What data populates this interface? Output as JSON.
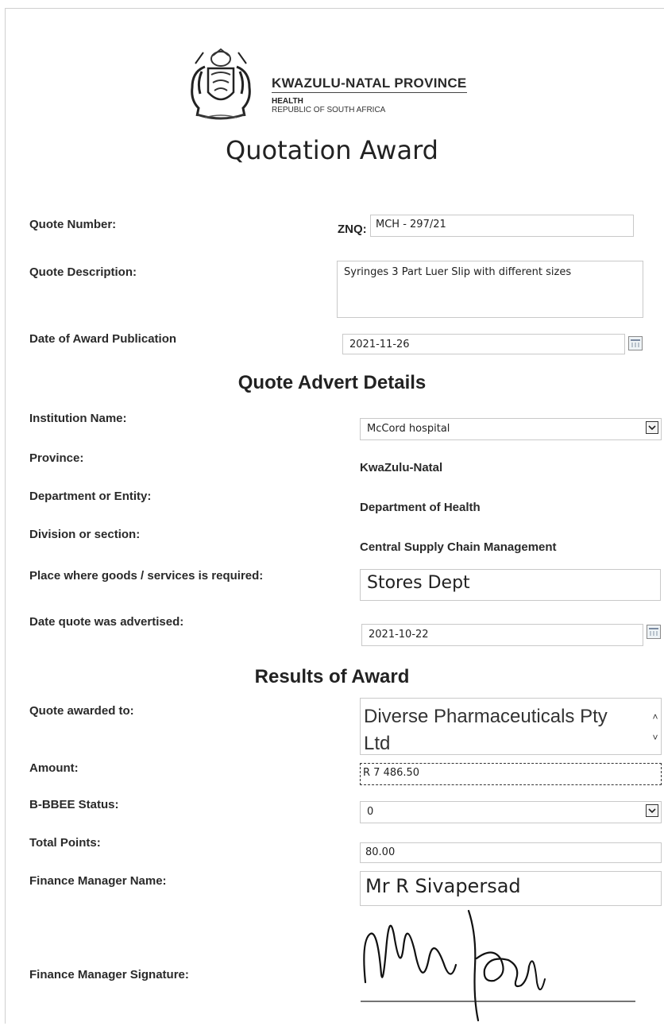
{
  "header": {
    "province_line": "KWAZULU-NATAL PROVINCE",
    "dept_line": "HEALTH",
    "country_line": "REPUBLIC OF SOUTH AFRICA"
  },
  "title": "Quotation Award",
  "quote": {
    "number_label": "Quote Number:",
    "number_prefix": "ZNQ:",
    "number_value": "MCH - 297/21",
    "description_label": "Quote Description:",
    "description_value": "Syringes 3 Part Luer Slip with different sizes",
    "award_date_label": "Date of Award Publication",
    "award_date_value": "2021-11-26"
  },
  "advert": {
    "heading": "Quote Advert Details",
    "institution_label": "Institution Name:",
    "institution_value": "McCord hospital",
    "province_label": "Province:",
    "province_value": "KwaZulu-Natal",
    "department_label": "Department or Entity:",
    "department_value": "Department of Health",
    "division_label": "Division or section:",
    "division_value": "Central Supply Chain Management",
    "place_label": "Place where goods /  services is required:",
    "place_value": "Stores Dept",
    "advertised_label": "Date quote was advertised:",
    "advertised_value": "2021-10-22"
  },
  "results": {
    "heading": "Results of Award",
    "awarded_label": "Quote awarded to:",
    "awarded_value_line1": "Diverse Pharmaceuticals Pty",
    "awarded_value_line2": "Ltd",
    "amount_label": "Amount:",
    "amount_value": "R 7 486.50",
    "bbbee_label": "B-BBEE Status:",
    "bbbee_value": "0",
    "points_label": "Total Points:",
    "points_value": "80.00",
    "manager_label": "Finance Manager Name:",
    "manager_value": "Mr R Sivapersad",
    "signature_label": "Finance Manager Signature:"
  },
  "icons": {
    "logo": "coat-of-arms-icon",
    "dropdown": "chevron-down-icon",
    "calendar": "calendar-icon",
    "scroll": "scroll-arrows-icon"
  }
}
